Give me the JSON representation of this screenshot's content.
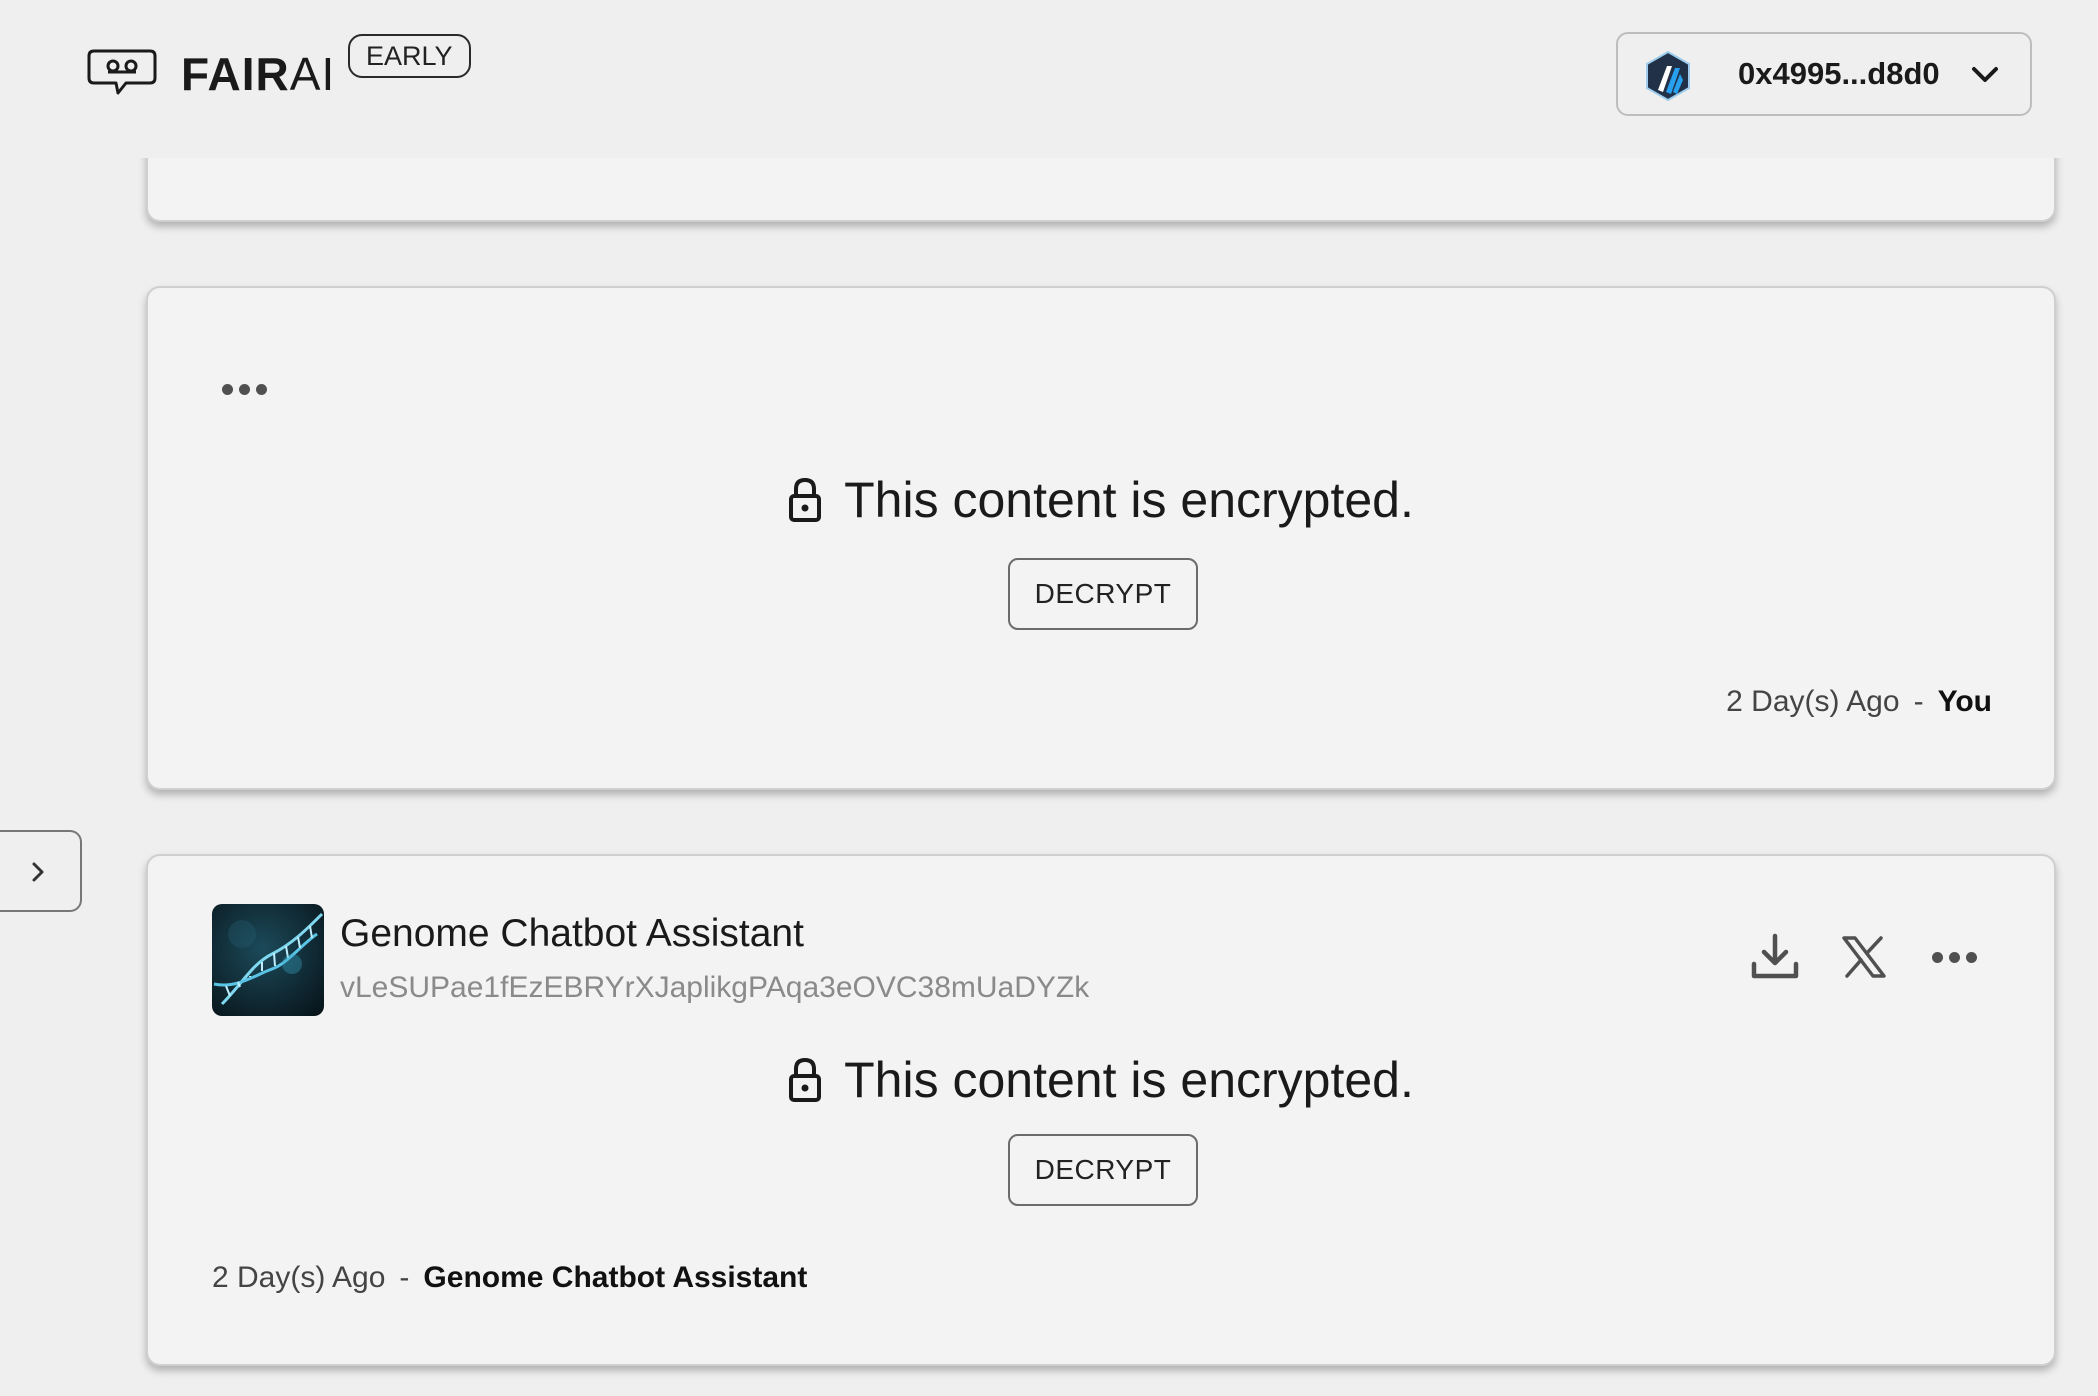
{
  "header": {
    "logo_icon": "chat-bubble-robot-icon",
    "brand_bold": "FAIR",
    "brand_light": "AI",
    "badge": "EARLY",
    "wallet": {
      "network_icon": "arbitrum-logo",
      "address": "0x4995...d8d0",
      "chevron_icon": "chevron-down-icon"
    }
  },
  "sidebar": {
    "toggle_icon": "chevron-right-icon"
  },
  "messages": [
    {
      "type": "user",
      "encrypted_text": "This content is encrypted.",
      "decrypt_label": "DECRYPT",
      "time": "2 Day(s) Ago",
      "separator": "-",
      "author": "You"
    },
    {
      "type": "assistant",
      "bot_name": "Genome Chatbot Assistant",
      "bot_id": "vLeSUPae1fEzEBRYrXJaplikgPAqa3eOVC38mUaDYZk",
      "encrypted_text": "This content is encrypted.",
      "decrypt_label": "DECRYPT",
      "time": "2 Day(s) Ago",
      "separator": "-",
      "author": "Genome Chatbot Assistant",
      "actions": [
        "download-icon",
        "x-share-icon",
        "more-options-icon"
      ]
    }
  ],
  "colors": {
    "background": "#efefef",
    "card": "#f3f3f3",
    "border": "#cfcfcf",
    "text": "#1a1a1a",
    "muted": "#8a8a8a",
    "arbitrum_blue": "#28a0f0",
    "arbitrum_navy": "#213147"
  }
}
